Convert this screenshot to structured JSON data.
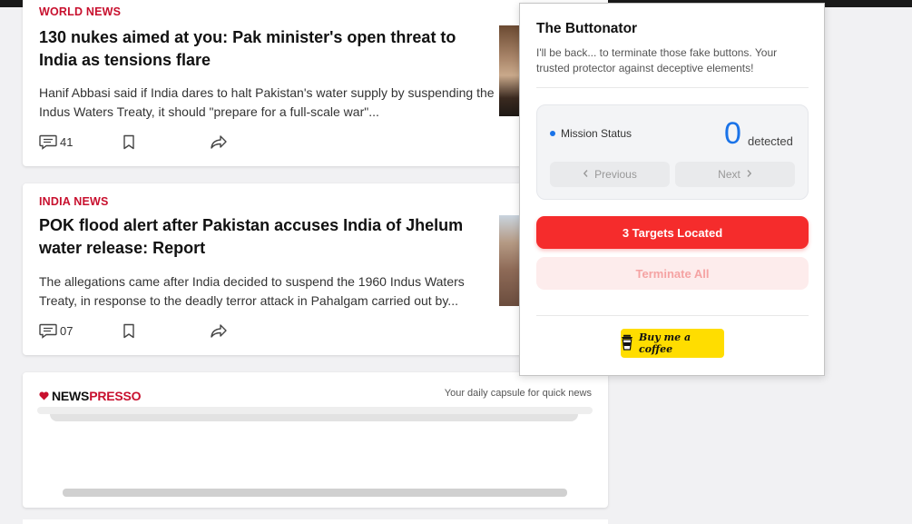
{
  "articles": [
    {
      "category": "WORLD NEWS",
      "headline": "130 nukes aimed at you: Pak minister's open threat to India as tensions flare",
      "summary": "Hanif Abbasi said if India dares to halt Pakistan's water supply by suspending the Indus Waters Treaty, it should \"prepare for a full-scale war\"...",
      "comments": "41"
    },
    {
      "category": "INDIA NEWS",
      "headline": "POK flood alert after Pakistan accuses India of Jhelum water release: Report",
      "summary": "The allegations came after India decided to suspend the 1960 Indus Waters Treaty, in response to the deadly terror attack in Pahalgam carried out by...",
      "comments": "07"
    }
  ],
  "newspresso": {
    "logo_news": "NEWS",
    "logo_presso": "PRESSO",
    "tagline": "Your daily capsule for quick news"
  },
  "popup": {
    "title": "The Buttonator",
    "description": "I'll be back... to terminate those fake buttons. Your trusted protector against deceptive elements!",
    "status_label": "Mission Status",
    "count": "0",
    "count_unit": "detected",
    "prev_label": "Previous",
    "next_label": "Next",
    "targets_label": "3 Targets Located",
    "terminate_label": "Terminate All",
    "coffee_label": "Buy me a coffee"
  },
  "colors": {
    "brand_red": "#c8102e",
    "accent_blue": "#1a73e8",
    "danger_red": "#f52c2c",
    "coffee_yellow": "#ffdd00"
  }
}
